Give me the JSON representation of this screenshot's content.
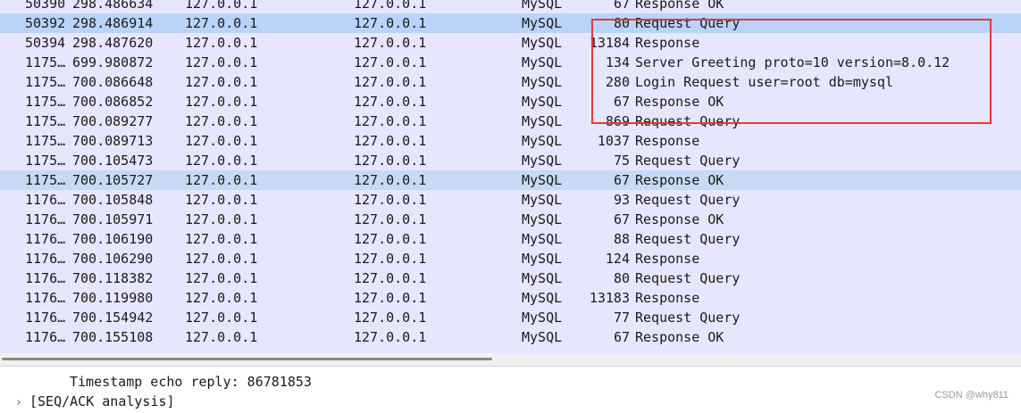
{
  "packet_list": {
    "rows": [
      {
        "no": "50390",
        "time": "298.486634",
        "source": "127.0.0.1",
        "destination": "127.0.0.1",
        "protocol": "MySQL",
        "length": "67",
        "info": "Response OK"
      },
      {
        "no": "50392",
        "time": "298.486914",
        "source": "127.0.0.1",
        "destination": "127.0.0.1",
        "protocol": "MySQL",
        "length": "80",
        "info": "Request Query",
        "selected": true
      },
      {
        "no": "50394",
        "time": "298.487620",
        "source": "127.0.0.1",
        "destination": "127.0.0.1",
        "protocol": "MySQL",
        "length": "13184",
        "info": "Response"
      },
      {
        "no": "1175…",
        "time": "699.980872",
        "source": "127.0.0.1",
        "destination": "127.0.0.1",
        "protocol": "MySQL",
        "length": "134",
        "info": "Server Greeting proto=10 version=8.0.12"
      },
      {
        "no": "1175…",
        "time": "700.086648",
        "source": "127.0.0.1",
        "destination": "127.0.0.1",
        "protocol": "MySQL",
        "length": "280",
        "info": "Login Request user=root db=mysql"
      },
      {
        "no": "1175…",
        "time": "700.086852",
        "source": "127.0.0.1",
        "destination": "127.0.0.1",
        "protocol": "MySQL",
        "length": "67",
        "info": "Response OK"
      },
      {
        "no": "1175…",
        "time": "700.089277",
        "source": "127.0.0.1",
        "destination": "127.0.0.1",
        "protocol": "MySQL",
        "length": "869",
        "info": "Request Query"
      },
      {
        "no": "1175…",
        "time": "700.089713",
        "source": "127.0.0.1",
        "destination": "127.0.0.1",
        "protocol": "MySQL",
        "length": "1037",
        "info": "Response"
      },
      {
        "no": "1175…",
        "time": "700.105473",
        "source": "127.0.0.1",
        "destination": "127.0.0.1",
        "protocol": "MySQL",
        "length": "75",
        "info": "Request Query"
      },
      {
        "no": "1175…",
        "time": "700.105727",
        "source": "127.0.0.1",
        "destination": "127.0.0.1",
        "protocol": "MySQL",
        "length": "67",
        "info": "Response OK",
        "hover": true
      },
      {
        "no": "1176…",
        "time": "700.105848",
        "source": "127.0.0.1",
        "destination": "127.0.0.1",
        "protocol": "MySQL",
        "length": "93",
        "info": "Request Query"
      },
      {
        "no": "1176…",
        "time": "700.105971",
        "source": "127.0.0.1",
        "destination": "127.0.0.1",
        "protocol": "MySQL",
        "length": "67",
        "info": "Response OK"
      },
      {
        "no": "1176…",
        "time": "700.106190",
        "source": "127.0.0.1",
        "destination": "127.0.0.1",
        "protocol": "MySQL",
        "length": "88",
        "info": "Request Query"
      },
      {
        "no": "1176…",
        "time": "700.106290",
        "source": "127.0.0.1",
        "destination": "127.0.0.1",
        "protocol": "MySQL",
        "length": "124",
        "info": "Response"
      },
      {
        "no": "1176…",
        "time": "700.118382",
        "source": "127.0.0.1",
        "destination": "127.0.0.1",
        "protocol": "MySQL",
        "length": "80",
        "info": "Request Query"
      },
      {
        "no": "1176…",
        "time": "700.119980",
        "source": "127.0.0.1",
        "destination": "127.0.0.1",
        "protocol": "MySQL",
        "length": "13183",
        "info": "Response"
      },
      {
        "no": "1176…",
        "time": "700.154942",
        "source": "127.0.0.1",
        "destination": "127.0.0.1",
        "protocol": "MySQL",
        "length": "77",
        "info": "Request Query"
      },
      {
        "no": "1176…",
        "time": "700.155108",
        "source": "127.0.0.1",
        "destination": "127.0.0.1",
        "protocol": "MySQL",
        "length": "67",
        "info": "Response OK"
      }
    ]
  },
  "details": {
    "timestamp_echo_reply": "Timestamp echo reply: 86781853",
    "seq_ack_analysis": "[SEQ/ACK analysis]",
    "chevron_glyph": "›"
  },
  "watermark": "CSDN @why811",
  "colors": {
    "list_background": "#e7e6ff",
    "selected_row": "#b9d4f9",
    "highlight_box": "#e03a3a"
  }
}
